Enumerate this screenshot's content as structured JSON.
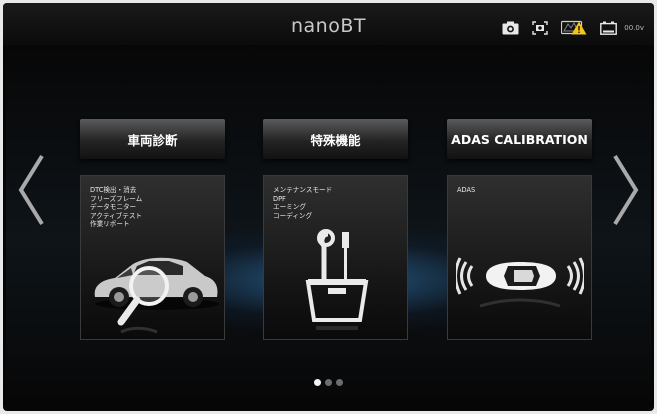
{
  "app": {
    "title": "nanoBT"
  },
  "status_bar": {
    "icons": [
      "camera-icon",
      "screenshot-icon",
      "vci-warning-icon",
      "battery-icon"
    ],
    "voltage": "00.0v"
  },
  "tiles": [
    {
      "title": "車両診断",
      "lines": [
        "DTC検出・消去",
        "フリーズフレーム",
        "データモニター",
        "アクティブテスト",
        "作業リポート"
      ],
      "illustration": "car-diagnosis-icon"
    },
    {
      "title": "特殊機能",
      "lines": [
        "メンテナンスモード",
        "DPF",
        "エーミング",
        "コーディング"
      ],
      "illustration": "toolbox-icon"
    },
    {
      "title": "ADAS CALIBRATION",
      "lines": [
        "ADAS"
      ],
      "illustration": "adas-car-icon"
    }
  ],
  "navigation": {
    "prev": "chevron-left-icon",
    "next": "chevron-right-icon"
  },
  "pagination": {
    "pages": 3,
    "current": 1
  },
  "colors": {
    "background": "#060606",
    "glow": "#3c96dc",
    "warning": "#f5c518",
    "text": "#ffffff"
  }
}
